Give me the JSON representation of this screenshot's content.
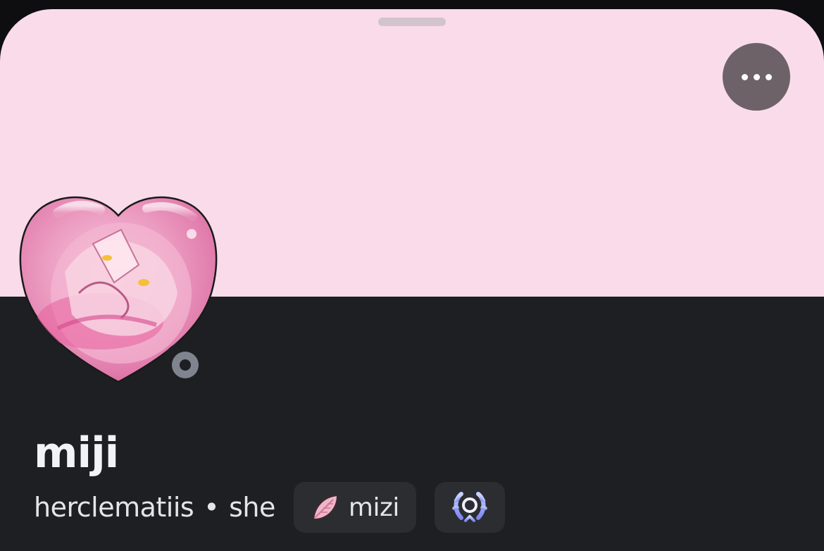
{
  "profile": {
    "display_name": "miji",
    "username": "herclematiis",
    "separator": "•",
    "pronouns": "she",
    "status": "offline",
    "avatar_icon": "heart-avatar-icon",
    "banner_color": "#f9dbe9"
  },
  "guild_tag": {
    "icon": "feather-leaf-icon",
    "label": "mizi"
  },
  "badge": {
    "icon": "laurel-wreath-icon"
  },
  "actions": {
    "more_icon": "ellipsis-icon"
  }
}
